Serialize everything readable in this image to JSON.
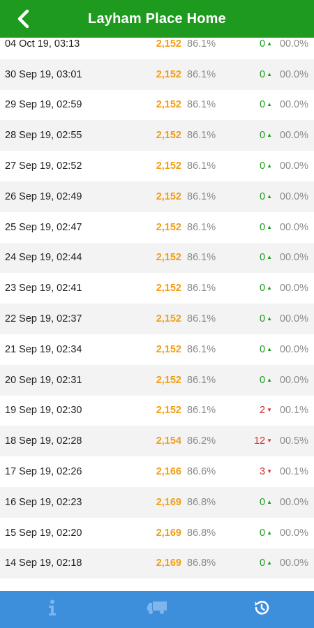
{
  "header": {
    "title": "Layham Place Home",
    "back_icon": "back-arrow-icon"
  },
  "rows": [
    {
      "date": "04 Oct 19, 03:13",
      "count": "2,152",
      "pct": "86.1%",
      "delta": "0",
      "dir": "up",
      "dpct": "00.0%"
    },
    {
      "date": "30 Sep 19, 03:01",
      "count": "2,152",
      "pct": "86.1%",
      "delta": "0",
      "dir": "up",
      "dpct": "00.0%"
    },
    {
      "date": "29 Sep 19, 02:59",
      "count": "2,152",
      "pct": "86.1%",
      "delta": "0",
      "dir": "up",
      "dpct": "00.0%"
    },
    {
      "date": "28 Sep 19, 02:55",
      "count": "2,152",
      "pct": "86.1%",
      "delta": "0",
      "dir": "up",
      "dpct": "00.0%"
    },
    {
      "date": "27 Sep 19, 02:52",
      "count": "2,152",
      "pct": "86.1%",
      "delta": "0",
      "dir": "up",
      "dpct": "00.0%"
    },
    {
      "date": "26 Sep 19, 02:49",
      "count": "2,152",
      "pct": "86.1%",
      "delta": "0",
      "dir": "up",
      "dpct": "00.0%"
    },
    {
      "date": "25 Sep 19, 02:47",
      "count": "2,152",
      "pct": "86.1%",
      "delta": "0",
      "dir": "up",
      "dpct": "00.0%"
    },
    {
      "date": "24 Sep 19, 02:44",
      "count": "2,152",
      "pct": "86.1%",
      "delta": "0",
      "dir": "up",
      "dpct": "00.0%"
    },
    {
      "date": "23 Sep 19, 02:41",
      "count": "2,152",
      "pct": "86.1%",
      "delta": "0",
      "dir": "up",
      "dpct": "00.0%"
    },
    {
      "date": "22 Sep 19, 02:37",
      "count": "2,152",
      "pct": "86.1%",
      "delta": "0",
      "dir": "up",
      "dpct": "00.0%"
    },
    {
      "date": "21 Sep 19, 02:34",
      "count": "2,152",
      "pct": "86.1%",
      "delta": "0",
      "dir": "up",
      "dpct": "00.0%"
    },
    {
      "date": "20 Sep 19, 02:31",
      "count": "2,152",
      "pct": "86.1%",
      "delta": "0",
      "dir": "up",
      "dpct": "00.0%"
    },
    {
      "date": "19 Sep 19, 02:30",
      "count": "2,152",
      "pct": "86.1%",
      "delta": "2",
      "dir": "down",
      "dpct": "00.1%"
    },
    {
      "date": "18 Sep 19, 02:28",
      "count": "2,154",
      "pct": "86.2%",
      "delta": "12",
      "dir": "down",
      "dpct": "00.5%"
    },
    {
      "date": "17 Sep 19, 02:26",
      "count": "2,166",
      "pct": "86.6%",
      "delta": "3",
      "dir": "down",
      "dpct": "00.1%"
    },
    {
      "date": "16 Sep 19, 02:23",
      "count": "2,169",
      "pct": "86.8%",
      "delta": "0",
      "dir": "up",
      "dpct": "00.0%"
    },
    {
      "date": "15 Sep 19, 02:20",
      "count": "2,169",
      "pct": "86.8%",
      "delta": "0",
      "dir": "up",
      "dpct": "00.0%"
    },
    {
      "date": "14 Sep 19, 02:18",
      "count": "2,169",
      "pct": "86.8%",
      "delta": "0",
      "dir": "up",
      "dpct": "00.0%"
    }
  ],
  "tabs": [
    {
      "icon": "info-icon"
    },
    {
      "icon": "truck-icon"
    },
    {
      "icon": "history-icon"
    }
  ],
  "colors": {
    "header": "#1e9a1e",
    "count": "#f39c12",
    "delta_up": "#1e9a1e",
    "delta_down": "#d32f2f",
    "tabbar": "#3d8fdc"
  }
}
